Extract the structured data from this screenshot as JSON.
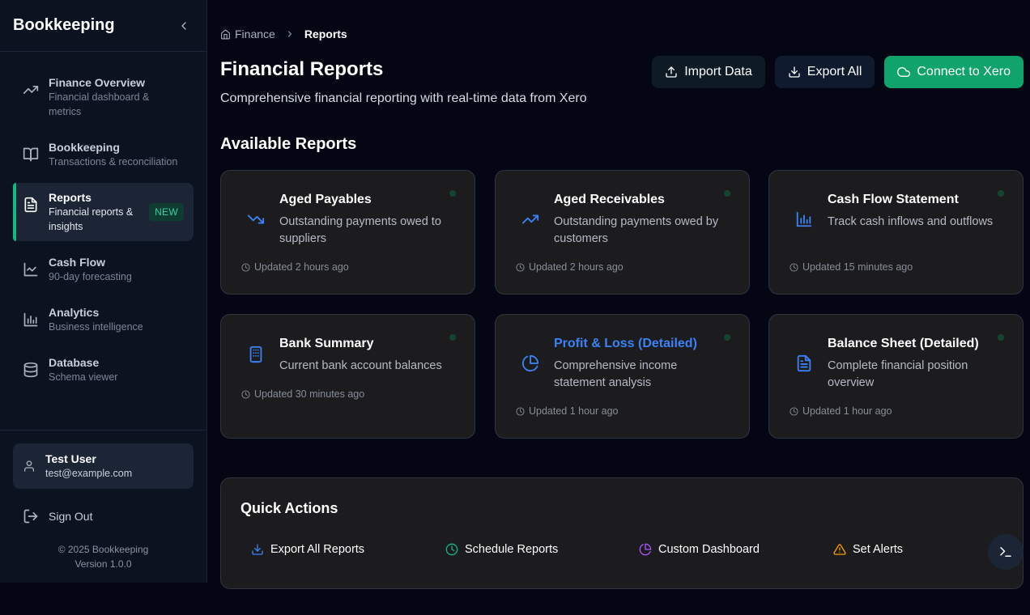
{
  "app": {
    "title": "Bookkeeping"
  },
  "sidebar": {
    "items": [
      {
        "label": "Finance Overview",
        "desc": "Financial dashboard & metrics",
        "icon": "trending-up-icon"
      },
      {
        "label": "Bookkeeping",
        "desc": "Transactions & reconciliation",
        "icon": "book-open-icon"
      },
      {
        "label": "Reports",
        "desc": "Financial reports & insights",
        "icon": "file-text-icon",
        "badge": "NEW",
        "active": true
      },
      {
        "label": "Cash Flow",
        "desc": "90-day forecasting",
        "icon": "line-chart-icon"
      },
      {
        "label": "Analytics",
        "desc": "Business intelligence",
        "icon": "bar-chart-icon"
      },
      {
        "label": "Database",
        "desc": "Schema viewer",
        "icon": "database-icon"
      }
    ],
    "user": {
      "name": "Test User",
      "email": "test@example.com"
    },
    "signout": "Sign Out",
    "copyright": "© 2025 Bookkeeping",
    "version": "Version 1.0.0"
  },
  "breadcrumb": {
    "parent": "Finance",
    "current": "Reports"
  },
  "header": {
    "title": "Financial Reports",
    "subtitle": "Comprehensive financial reporting with real-time data from Xero",
    "import_label": "Import Data",
    "export_label": "Export All",
    "connect_label": "Connect to Xero"
  },
  "reports": {
    "section_title": "Available Reports",
    "cards": [
      {
        "title": "Aged Payables",
        "desc": "Outstanding payments owed to suppliers",
        "updated": "Updated 2 hours ago",
        "icon": "trending-down-icon"
      },
      {
        "title": "Aged Receivables",
        "desc": "Outstanding payments owed by customers",
        "updated": "Updated 2 hours ago",
        "icon": "trending-up-icon"
      },
      {
        "title": "Cash Flow Statement",
        "desc": "Track cash inflows and outflows",
        "updated": "Updated 15 minutes ago",
        "icon": "bar-chart-icon"
      },
      {
        "title": "Bank Summary",
        "desc": "Current bank account balances",
        "updated": "Updated 30 minutes ago",
        "icon": "building-icon"
      },
      {
        "title": "Profit & Loss (Detailed)",
        "desc": "Comprehensive income statement analysis",
        "updated": "Updated 1 hour ago",
        "icon": "pie-chart-icon"
      },
      {
        "title": "Balance Sheet (Detailed)",
        "desc": "Complete financial position overview",
        "updated": "Updated 1 hour ago",
        "icon": "file-text-icon"
      }
    ]
  },
  "quick_actions": {
    "title": "Quick Actions",
    "items": [
      {
        "label": "Export All Reports",
        "icon": "download-icon",
        "color": "#3b82f6"
      },
      {
        "label": "Schedule Reports",
        "icon": "clock-icon",
        "color": "#10b981"
      },
      {
        "label": "Custom Dashboard",
        "icon": "pie-chart-icon",
        "color": "#a855f7"
      },
      {
        "label": "Set Alerts",
        "icon": "alert-triangle-icon",
        "color": "#f59e0b"
      }
    ]
  },
  "colors": {
    "accent": "#10b981",
    "link": "#3b82f6",
    "bg": "#040613",
    "card": "#1c1c1f"
  }
}
